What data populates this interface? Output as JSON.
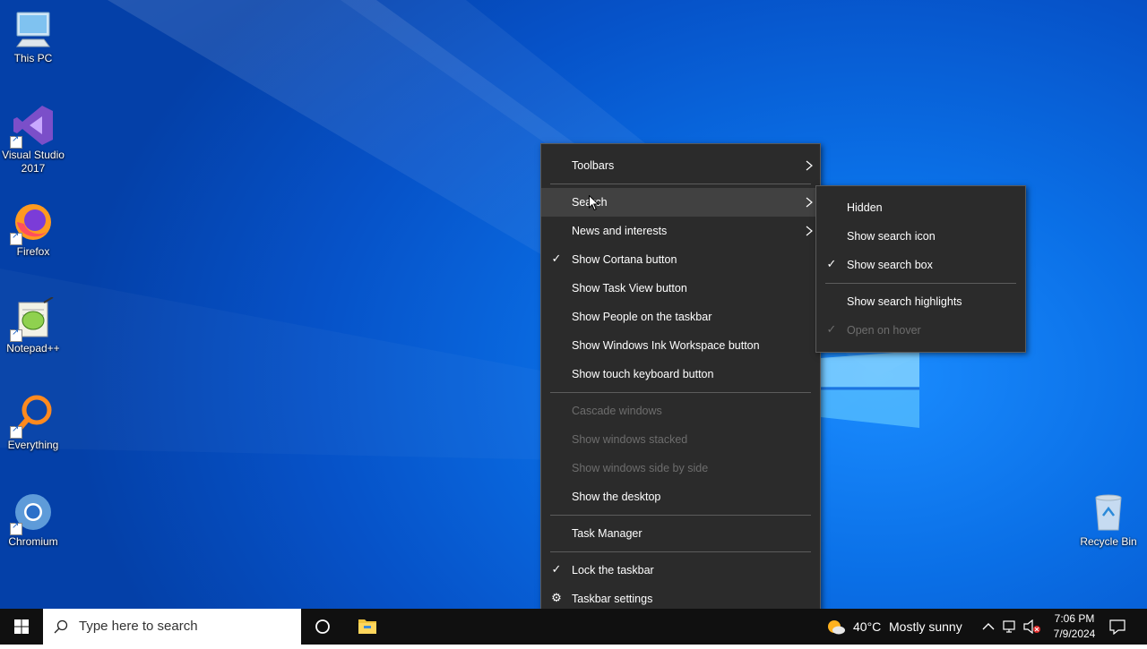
{
  "desktop_icons": [
    {
      "label": "This PC",
      "icon": "this-pc-icon"
    },
    {
      "label": "Visual Studio 2017",
      "icon": "visual-studio-icon"
    },
    {
      "label": "Firefox",
      "icon": "firefox-icon"
    },
    {
      "label": "Notepad++",
      "icon": "notepad-plus-plus-icon"
    },
    {
      "label": "Everything",
      "icon": "everything-icon"
    },
    {
      "label": "Chromium",
      "icon": "chromium-icon"
    },
    {
      "label": "Recycle Bin",
      "icon": "recycle-bin-icon"
    }
  ],
  "context_menu": {
    "items": [
      {
        "label": "Toolbars",
        "submenu": true
      },
      {
        "label": "Search",
        "submenu": true,
        "highlighted": true
      },
      {
        "label": "News and interests",
        "submenu": true
      },
      {
        "label": "Show Cortana button",
        "checked": true
      },
      {
        "label": "Show Task View button"
      },
      {
        "label": "Show People on the taskbar"
      },
      {
        "label": "Show Windows Ink Workspace button"
      },
      {
        "label": "Show touch keyboard button"
      },
      {
        "label": "Cascade windows",
        "disabled": true
      },
      {
        "label": "Show windows stacked",
        "disabled": true
      },
      {
        "label": "Show windows side by side",
        "disabled": true
      },
      {
        "label": "Show the desktop"
      },
      {
        "label": "Task Manager"
      },
      {
        "label": "Lock the taskbar",
        "checked": true
      },
      {
        "label": "Taskbar settings",
        "icon": "gear-icon"
      }
    ]
  },
  "search_submenu": {
    "items": [
      {
        "label": "Hidden"
      },
      {
        "label": "Show search icon"
      },
      {
        "label": "Show search box",
        "checked": true
      },
      {
        "label": "Show search highlights"
      },
      {
        "label": "Open on hover",
        "checked": true,
        "disabled": true
      }
    ]
  },
  "taskbar": {
    "search_placeholder": "Type here to search",
    "weather": {
      "temp": "40°C",
      "condition": "Mostly sunny"
    },
    "clock": {
      "time": "7:06 PM",
      "date": "7/9/2024"
    }
  },
  "colors": {
    "menu_bg": "#2b2b2b",
    "menu_highlight": "#414141",
    "menu_disabled_text": "#6d6d6d",
    "taskbar_bg": "#101010",
    "desktop_blue": "#0a6fe6"
  }
}
